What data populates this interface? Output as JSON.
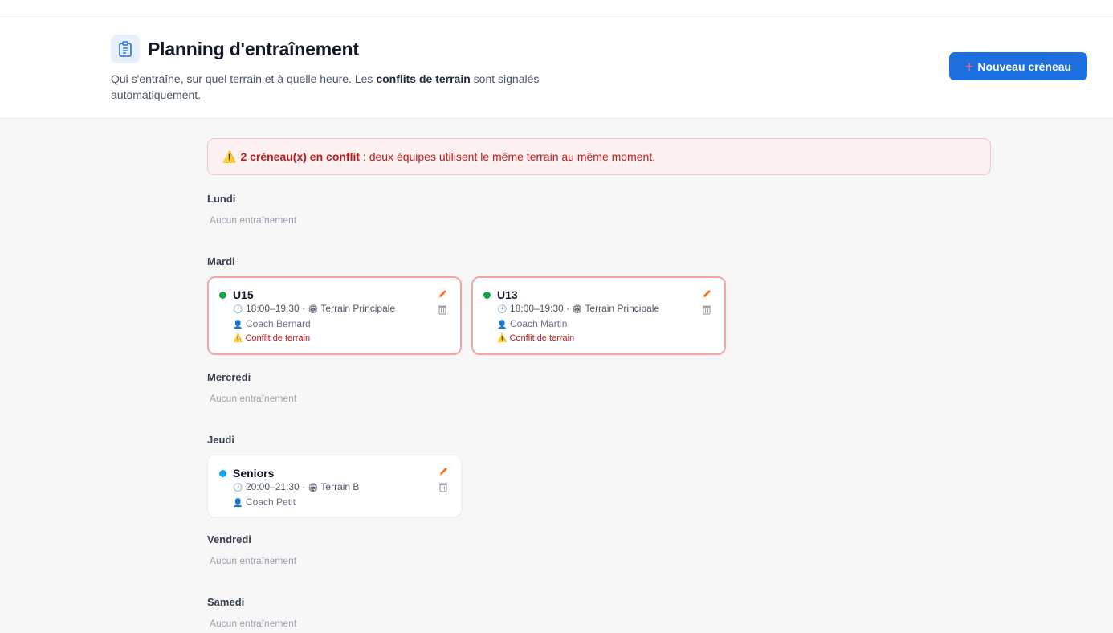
{
  "header": {
    "title": "Planning d'entraînement",
    "subtitle_part1": "Qui s'entraîne, sur quel terrain et à quelle heure. Les ",
    "subtitle_bold": "conflits de terrain",
    "subtitle_part2": " sont signalés automatiquement.",
    "new_button_label": "Nouveau créneau",
    "new_button_plus": "+"
  },
  "alert": {
    "icon": "⚠️",
    "bold": "2 créneau(x) en conflit",
    "text": " : deux équipes utilisent le même terrain au même moment."
  },
  "days": {
    "lundi": {
      "name": "Lundi",
      "empty": "Aucun entraînement"
    },
    "mardi": {
      "name": "Mardi",
      "slots": [
        {
          "team": "U15",
          "time": "18:00–19:30 ·",
          "field": "Terrain Principale",
          "coach": "Coach Bernard",
          "conflict": "Conflit de terrain",
          "dot_color": "#16a34a"
        },
        {
          "team": "U13",
          "time": "18:00–19:30 ·",
          "field": "Terrain Principale",
          "coach": "Coach Martin",
          "conflict": "Conflit de terrain",
          "dot_color": "#16a34a"
        }
      ]
    },
    "mercredi": {
      "name": "Mercredi",
      "empty": "Aucun entraînement"
    },
    "jeudi": {
      "name": "Jeudi",
      "slots": [
        {
          "team": "Seniors",
          "time": "20:00–21:30 ·",
          "field": "Terrain B",
          "coach": "Coach Petit",
          "dot_color": "#0ea5e9"
        }
      ]
    },
    "vendredi": {
      "name": "Vendredi",
      "empty": "Aucun entraînement"
    },
    "samedi": {
      "name": "Samedi",
      "empty": "Aucun entraînement"
    }
  },
  "icons": {
    "clock": "🕐",
    "stadium": "🏟",
    "coach": "👤",
    "warning": "⚠️"
  },
  "colors": {
    "primary": "#1d6fe0",
    "conflict_border": "#f3a5a5",
    "conflict_text": "#b91c1c",
    "edit_icon": "#f97316"
  }
}
